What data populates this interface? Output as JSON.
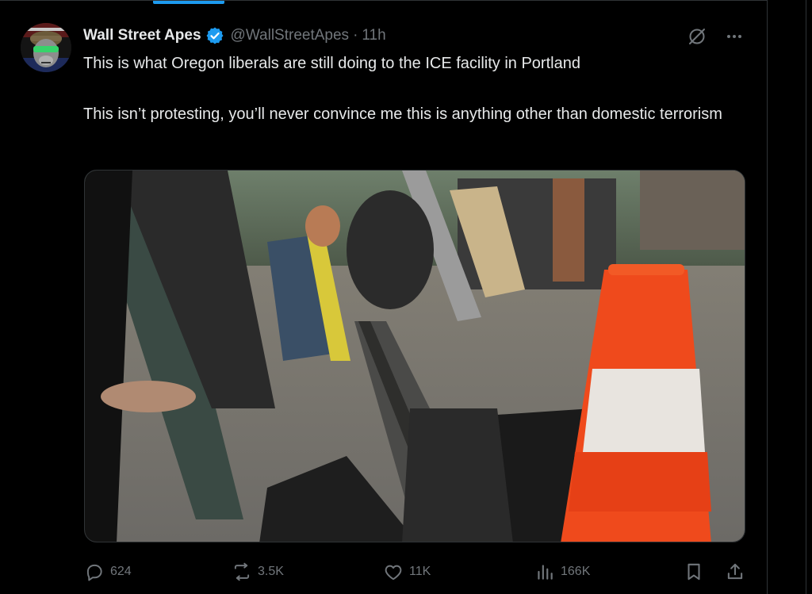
{
  "author": {
    "display_name": "Wall Street Apes",
    "handle": "@WallStreetApes",
    "separator": "·",
    "time": "11h",
    "verified": true
  },
  "tweet": {
    "paragraphs": [
      "This is what Oregon liberals are still doing to the ICE facility in Portland",
      "This isn’t protesting, you’ll never convince me this is anything other than domestic terrorism"
    ]
  },
  "media": {
    "type": "video"
  },
  "actions": {
    "replies": "624",
    "reposts": "3.5K",
    "likes": "11K",
    "views": "166K"
  },
  "icons": {
    "verified": "verified-badge-icon",
    "grok": "grok-icon",
    "more": "more-icon",
    "reply": "reply-icon",
    "repost": "repost-icon",
    "like": "like-icon",
    "views": "views-icon",
    "bookmark": "bookmark-icon",
    "share": "share-icon"
  },
  "colors": {
    "background": "#000000",
    "text": "#e7e9ea",
    "secondary_text": "#71767b",
    "accent": "#1d9bf0",
    "border": "#2f3336"
  }
}
